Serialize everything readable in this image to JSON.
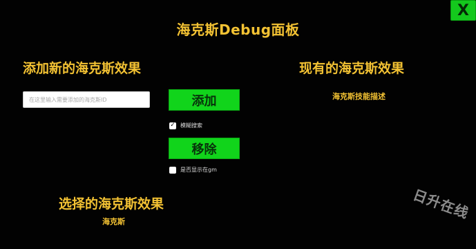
{
  "window": {
    "title": "海克斯Debug面板",
    "close_label": "X"
  },
  "add_section": {
    "heading": "添加新的海克斯效果",
    "input_placeholder": "在这里输入需要添加的海克斯ID",
    "input_value": "",
    "add_button": "添加",
    "fuzzy_search_label": "模糊搜索",
    "fuzzy_search_checked": true,
    "remove_button": "移除",
    "show_in_gm_label": "是否显示在gm",
    "show_in_gm_checked": false
  },
  "existing_section": {
    "heading": "现有的海克斯效果",
    "description": "海克斯技能描述"
  },
  "selected_section": {
    "heading": "选择的海克斯效果",
    "value": "海克斯"
  },
  "watermark": {
    "text": "日升在线"
  },
  "colors": {
    "accent_text": "#f3c233",
    "button_green": "#11d41b",
    "background": "#020202"
  }
}
